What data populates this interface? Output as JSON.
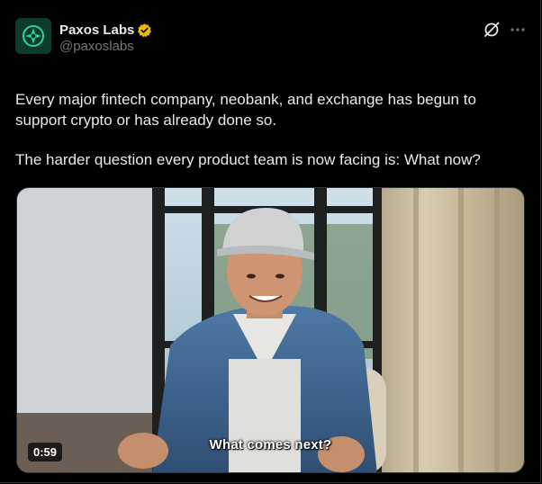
{
  "author": {
    "display_name": "Paxos Labs",
    "handle": "@paxoslabs",
    "verified": true,
    "verified_color": "#e8b80c",
    "avatar_bg": "#0d3b2c"
  },
  "tweet": {
    "paragraphs": [
      "Every major fintech company, neobank, and exchange has begun to support crypto or has already done so.",
      "The harder question every product team is now facing is: What now?"
    ]
  },
  "video": {
    "duration": "0:59",
    "caption": "What comes next?"
  },
  "icons": {
    "grok": "grok-icon",
    "more": "more-options-icon",
    "verified": "verified-badge-icon",
    "avatar": "paxos-labs-logo"
  },
  "colors": {
    "background": "#000000",
    "text": "#e7e9ea",
    "secondary_text": "#71767b",
    "border": "#2f3336"
  }
}
